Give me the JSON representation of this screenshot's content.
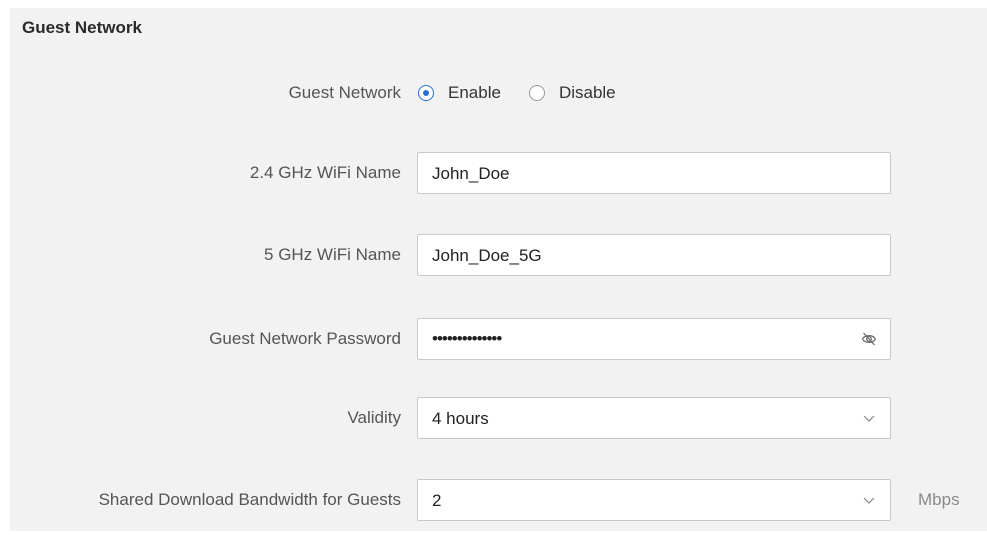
{
  "section": {
    "title": "Guest Network"
  },
  "guest_network": {
    "label": "Guest Network",
    "options": [
      {
        "label": "Enable",
        "checked": true
      },
      {
        "label": "Disable",
        "checked": false
      }
    ]
  },
  "wifi_24": {
    "label": "2.4 GHz WiFi Name",
    "value": "John_Doe"
  },
  "wifi_5": {
    "label": "5 GHz WiFi Name",
    "value": "John_Doe_5G"
  },
  "password": {
    "label": "Guest Network Password",
    "masked_value": "••••••••••••••",
    "toggle_icon": "eye-slash-icon"
  },
  "validity": {
    "label": "Validity",
    "value": "4 hours",
    "icon": "chevron-down-icon"
  },
  "bandwidth": {
    "label": "Shared Download Bandwidth for Guests",
    "value": "2",
    "unit": "Mbps",
    "icon": "chevron-down-icon"
  },
  "colors": {
    "panel_bg": "#f2f2f2",
    "accent": "#2a6fd6",
    "border": "#c8c8c8"
  }
}
